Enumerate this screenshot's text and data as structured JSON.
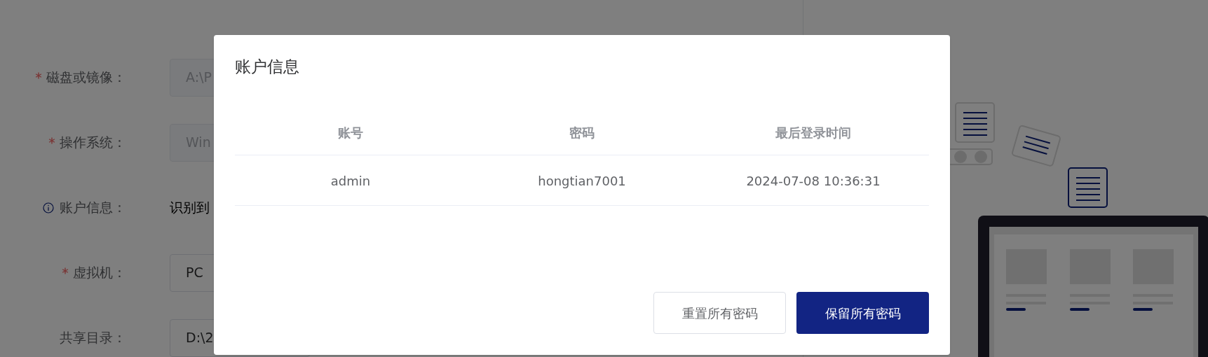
{
  "form": {
    "fields": [
      {
        "label": "磁盘或镜像：",
        "required": true,
        "info": false,
        "kind": "input",
        "disabled": true,
        "value": "A:\\P"
      },
      {
        "label": "操作系统：",
        "required": true,
        "info": false,
        "kind": "input",
        "disabled": true,
        "value": "Win"
      },
      {
        "label": "账户信息：",
        "required": false,
        "info": true,
        "kind": "text",
        "value": "识别到"
      },
      {
        "label": "虚拟机：",
        "required": true,
        "info": false,
        "kind": "input",
        "disabled": false,
        "value": "PC"
      },
      {
        "label": "共享目录：",
        "required": false,
        "info": false,
        "kind": "input",
        "disabled": false,
        "value": "D:\\2"
      }
    ]
  },
  "dialog": {
    "title": "账户信息",
    "table": {
      "columns": [
        "账号",
        "密码",
        "最后登录时间"
      ],
      "rows": [
        [
          "admin",
          "hongtian7001",
          "2024-07-08 10:36:31"
        ]
      ]
    },
    "buttons": [
      {
        "label": "重置所有密码",
        "kind": "default"
      },
      {
        "label": "保留所有密码",
        "kind": "primary"
      }
    ]
  }
}
